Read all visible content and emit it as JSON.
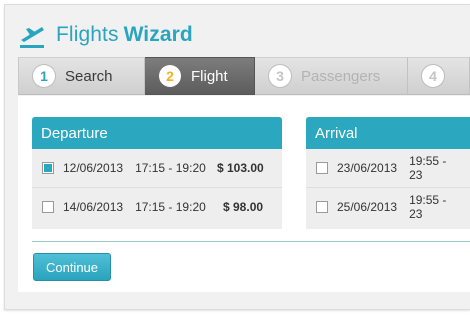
{
  "app": {
    "title_light": "Flights",
    "title_bold": "Wizard",
    "accent_color": "#2aa5bf",
    "logo_icon": "airplane-takeoff-icon"
  },
  "steps": [
    {
      "num": "1",
      "label": "Search",
      "state": "done"
    },
    {
      "num": "2",
      "label": "Flight",
      "state": "active"
    },
    {
      "num": "3",
      "label": "Passengers",
      "state": "disabled"
    },
    {
      "num": "4",
      "label": "",
      "state": "disabled"
    }
  ],
  "departure": {
    "heading": "Departure",
    "rows": [
      {
        "date": "12/06/2013",
        "time": "17:15 - 19:20",
        "price": "$ 103.00",
        "checked": true
      },
      {
        "date": "14/06/2013",
        "time": "17:15 - 19:20",
        "price": "$ 98.00",
        "checked": false
      }
    ]
  },
  "arrival": {
    "heading": "Arrival",
    "rows": [
      {
        "date": "23/06/2013",
        "time": "19:55 - 23",
        "checked": false
      },
      {
        "date": "25/06/2013",
        "time": "19:55 - 23",
        "checked": false
      }
    ]
  },
  "actions": {
    "continue_label": "Continue"
  }
}
